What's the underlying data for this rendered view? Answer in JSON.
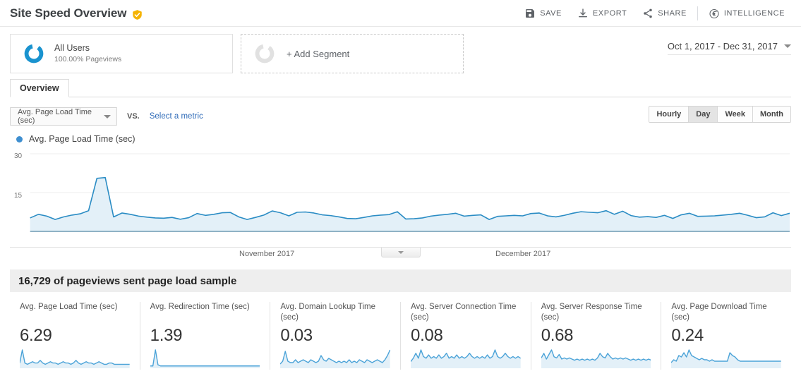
{
  "header": {
    "title": "Site Speed Overview",
    "verified_icon": "verified-shield-icon",
    "actions": [
      {
        "label": "SAVE",
        "icon": "save-floppy-icon"
      },
      {
        "label": "EXPORT",
        "icon": "export-download-icon"
      },
      {
        "label": "SHARE",
        "icon": "share-nodes-icon"
      },
      {
        "label": "INTELLIGENCE",
        "icon": "intelligence-swirl-icon"
      }
    ]
  },
  "segments": {
    "all_users": {
      "name": "All Users",
      "sub": "100.00% Pageviews",
      "icon": "blue-donut-icon"
    },
    "add_segment": {
      "label": "+ Add Segment",
      "icon": "gray-donut-icon"
    }
  },
  "date_range": {
    "value": "Oct 1, 2017 - Dec 31, 2017",
    "caret_icon": "chevron-down-icon"
  },
  "tabs": [
    {
      "label": "Overview",
      "active": true
    }
  ],
  "controls": {
    "metric_select": "Avg. Page Load Time (sec)",
    "metric_caret_icon": "chevron-down-icon",
    "vs_label": "VS.",
    "select_metric_link": "Select a metric",
    "granularity": [
      {
        "label": "Hourly",
        "active": false
      },
      {
        "label": "Day",
        "active": true
      },
      {
        "label": "Week",
        "active": false
      },
      {
        "label": "Month",
        "active": false
      }
    ]
  },
  "sample_banner": {
    "text": "16,729 of pageviews sent page load sample"
  },
  "colors": {
    "line": "#2a8cc4",
    "fill": "#e3f0f8",
    "legend_dot": "#3f8fd0",
    "link": "#2f6bb8",
    "badge": "#f5b301"
  },
  "chart_data": {
    "type": "area",
    "title": "Avg. Page Load Time (sec)",
    "legend": [
      "Avg. Page Load Time (sec)"
    ],
    "legend_position": "top-left",
    "grid": true,
    "xlabel": "",
    "ylabel": "",
    "ylim": [
      0,
      30
    ],
    "yticks": [
      15,
      30
    ],
    "xtick_labels": [
      "November 2017",
      "December 2017"
    ],
    "x": [
      "Oct 1",
      "Oct 2",
      "Oct 3",
      "Oct 4",
      "Oct 5",
      "Oct 6",
      "Oct 7",
      "Oct 8",
      "Oct 9",
      "Oct 10",
      "Oct 11",
      "Oct 12",
      "Oct 13",
      "Oct 14",
      "Oct 15",
      "Oct 16",
      "Oct 17",
      "Oct 18",
      "Oct 19",
      "Oct 20",
      "Oct 21",
      "Oct 22",
      "Oct 23",
      "Oct 24",
      "Oct 25",
      "Oct 26",
      "Oct 27",
      "Oct 28",
      "Oct 29",
      "Oct 30",
      "Oct 31",
      "Nov 1",
      "Nov 2",
      "Nov 3",
      "Nov 4",
      "Nov 5",
      "Nov 6",
      "Nov 7",
      "Nov 8",
      "Nov 9",
      "Nov 10",
      "Nov 11",
      "Nov 12",
      "Nov 13",
      "Nov 14",
      "Nov 15",
      "Nov 16",
      "Nov 17",
      "Nov 18",
      "Nov 19",
      "Nov 20",
      "Nov 21",
      "Nov 22",
      "Nov 23",
      "Nov 24",
      "Nov 25",
      "Nov 26",
      "Nov 27",
      "Nov 28",
      "Nov 29",
      "Nov 30",
      "Dec 1",
      "Dec 2",
      "Dec 3",
      "Dec 4",
      "Dec 5",
      "Dec 6",
      "Dec 7",
      "Dec 8",
      "Dec 9",
      "Dec 10",
      "Dec 11",
      "Dec 12",
      "Dec 13",
      "Dec 14",
      "Dec 15",
      "Dec 16",
      "Dec 17",
      "Dec 18",
      "Dec 19",
      "Dec 20",
      "Dec 21",
      "Dec 22",
      "Dec 23",
      "Dec 24",
      "Dec 25",
      "Dec 26",
      "Dec 27",
      "Dec 28",
      "Dec 29",
      "Dec 30",
      "Dec 31"
    ],
    "series": [
      {
        "name": "Avg. Page Load Time (sec)",
        "values": [
          5.2,
          6.6,
          5.9,
          4.6,
          5.6,
          6.3,
          6.8,
          8.0,
          20.5,
          20.8,
          5.6,
          7.1,
          6.6,
          5.9,
          5.5,
          5.2,
          5.1,
          5.4,
          4.7,
          5.3,
          6.9,
          6.2,
          6.6,
          7.2,
          7.3,
          5.6,
          4.6,
          5.4,
          6.3,
          7.9,
          7.2,
          6.0,
          7.4,
          7.5,
          7.1,
          6.4,
          6.1,
          5.6,
          5.0,
          4.9,
          5.4,
          6.0,
          6.3,
          6.5,
          7.6,
          4.8,
          4.9,
          5.2,
          5.9,
          6.3,
          6.6,
          7.0,
          5.9,
          6.2,
          6.4,
          4.6,
          5.8,
          6.0,
          6.2,
          6.0,
          6.9,
          7.1,
          6.0,
          5.6,
          6.2,
          7.0,
          7.6,
          7.4,
          7.2,
          8.0,
          6.6,
          7.8,
          6.1,
          5.5,
          5.7,
          5.4,
          6.2,
          5.0,
          6.4,
          7.0,
          5.8,
          5.9,
          6.0,
          6.3,
          6.6,
          7.0,
          6.2,
          5.3,
          5.6,
          7.2,
          6.1,
          7.0
        ]
      }
    ]
  },
  "metric_cards": [
    {
      "title": "Avg. Page Load Time (sec)",
      "value": "6.29",
      "sparkline": [
        4,
        14,
        4,
        3,
        4,
        5,
        4,
        4,
        6,
        4,
        3,
        4,
        5,
        4,
        4,
        3,
        4,
        5,
        4,
        4,
        3,
        4,
        6,
        4,
        3,
        4,
        5,
        4,
        4,
        3,
        4,
        5,
        4,
        3,
        3,
        4,
        4,
        3,
        3,
        3,
        3,
        3,
        3,
        3
      ]
    },
    {
      "title": "Avg. Redirection Time (sec)",
      "value": "1.39",
      "sparkline": [
        2,
        2,
        16,
        3,
        2,
        2,
        2,
        2,
        2,
        2,
        2,
        2,
        2,
        2,
        2,
        2,
        2,
        2,
        2,
        2,
        2,
        2,
        2,
        2,
        2,
        2,
        2,
        2,
        2,
        2,
        2,
        2,
        2,
        2,
        2,
        2,
        2,
        2,
        2,
        2,
        2,
        2,
        2,
        2
      ]
    },
    {
      "title": "Avg. Domain Lookup Time (sec)",
      "value": "0.03",
      "sparkline": [
        3,
        5,
        12,
        5,
        4,
        4,
        6,
        4,
        5,
        6,
        5,
        4,
        6,
        5,
        4,
        5,
        9,
        6,
        5,
        7,
        6,
        5,
        4,
        5,
        4,
        5,
        4,
        6,
        4,
        5,
        4,
        6,
        5,
        4,
        6,
        5,
        4,
        5,
        6,
        5,
        4,
        6,
        9,
        13
      ]
    },
    {
      "title": "Avg. Server Connection Time (sec)",
      "value": "0.08",
      "sparkline": [
        4,
        6,
        9,
        6,
        11,
        7,
        6,
        8,
        6,
        7,
        6,
        8,
        6,
        7,
        9,
        6,
        7,
        6,
        8,
        6,
        7,
        6,
        7,
        9,
        7,
        6,
        7,
        6,
        7,
        6,
        8,
        6,
        7,
        11,
        7,
        6,
        7,
        9,
        7,
        6,
        7,
        6,
        7,
        6
      ]
    },
    {
      "title": "Avg. Server Response Time (sec)",
      "value": "0.68",
      "sparkline": [
        9,
        13,
        8,
        12,
        16,
        10,
        9,
        12,
        8,
        9,
        8,
        9,
        8,
        7,
        8,
        7,
        8,
        7,
        8,
        7,
        8,
        7,
        9,
        13,
        10,
        9,
        13,
        10,
        8,
        9,
        8,
        9,
        8,
        9,
        8,
        7,
        8,
        7,
        8,
        7,
        8,
        7,
        8,
        7
      ]
    },
    {
      "title": "Avg. Page Download Time (sec)",
      "value": "0.24",
      "sparkline": [
        4,
        6,
        5,
        9,
        8,
        11,
        8,
        13,
        9,
        8,
        7,
        6,
        7,
        6,
        6,
        5,
        6,
        5,
        5,
        5,
        5,
        5,
        5,
        11,
        9,
        8,
        6,
        5,
        5,
        5,
        5,
        5,
        5,
        5,
        5,
        5,
        5,
        5,
        5,
        5,
        5,
        5,
        5,
        5
      ]
    }
  ]
}
